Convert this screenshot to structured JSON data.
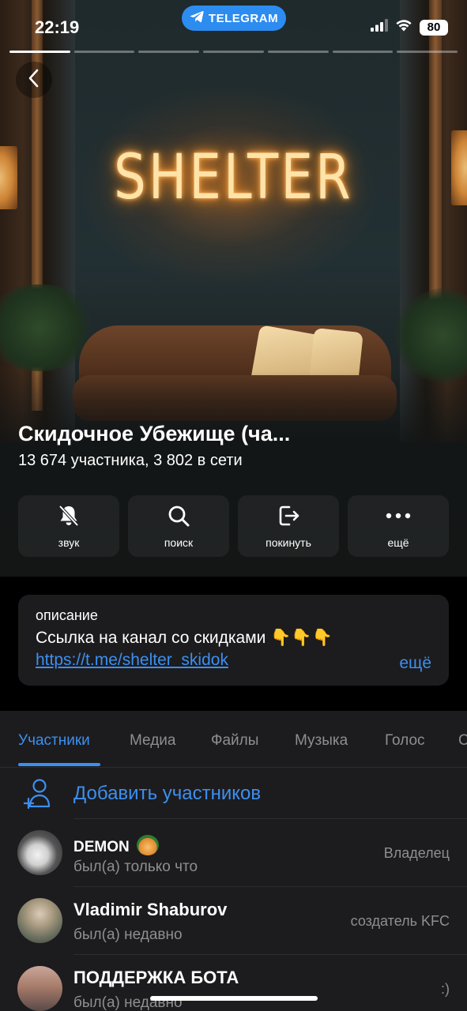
{
  "status_bar": {
    "time": "22:19",
    "app_pill": "TELEGRAM",
    "battery": "80"
  },
  "story_progress": {
    "segments": 7,
    "active_index": 0
  },
  "hero": {
    "neon_text": "SHELTER"
  },
  "channel": {
    "title": "Скидочное Убежище (ча...",
    "subtitle": "13 674 участника, 3 802 в сети"
  },
  "actions": [
    {
      "label": "звук",
      "icon": "bell-slash-icon"
    },
    {
      "label": "поиск",
      "icon": "search-icon"
    },
    {
      "label": "покинуть",
      "icon": "leave-icon"
    },
    {
      "label": "ещё",
      "icon": "more-icon"
    }
  ],
  "description": {
    "label": "описание",
    "text": "Ссылка на канал со скидками 👇👇👇",
    "link": "https://t.me/shelter_skidok",
    "more": "ещё"
  },
  "tabs": [
    {
      "label": "Участники",
      "active": true
    },
    {
      "label": "Медиа",
      "active": false
    },
    {
      "label": "Файлы",
      "active": false
    },
    {
      "label": "Музыка",
      "active": false
    },
    {
      "label": "Голос",
      "active": false
    },
    {
      "label": "С",
      "active": false
    }
  ],
  "add_members": {
    "label": "Добавить участников"
  },
  "members": [
    {
      "name": "DEMON",
      "status": "был(а) только что",
      "role": "Владелец"
    },
    {
      "name": "Vladimir Shaburov",
      "status": "был(а) недавно",
      "role": "создатель KFC"
    },
    {
      "name": "ПОДДЕРЖКА БОТА",
      "status": "был(а) недавно",
      "role": ":)"
    }
  ],
  "colors": {
    "accent": "#3d8ff0",
    "telegram_blue": "#2d8cf0",
    "panel": "#1c1c1e",
    "secondary_text": "#8e8e93"
  }
}
